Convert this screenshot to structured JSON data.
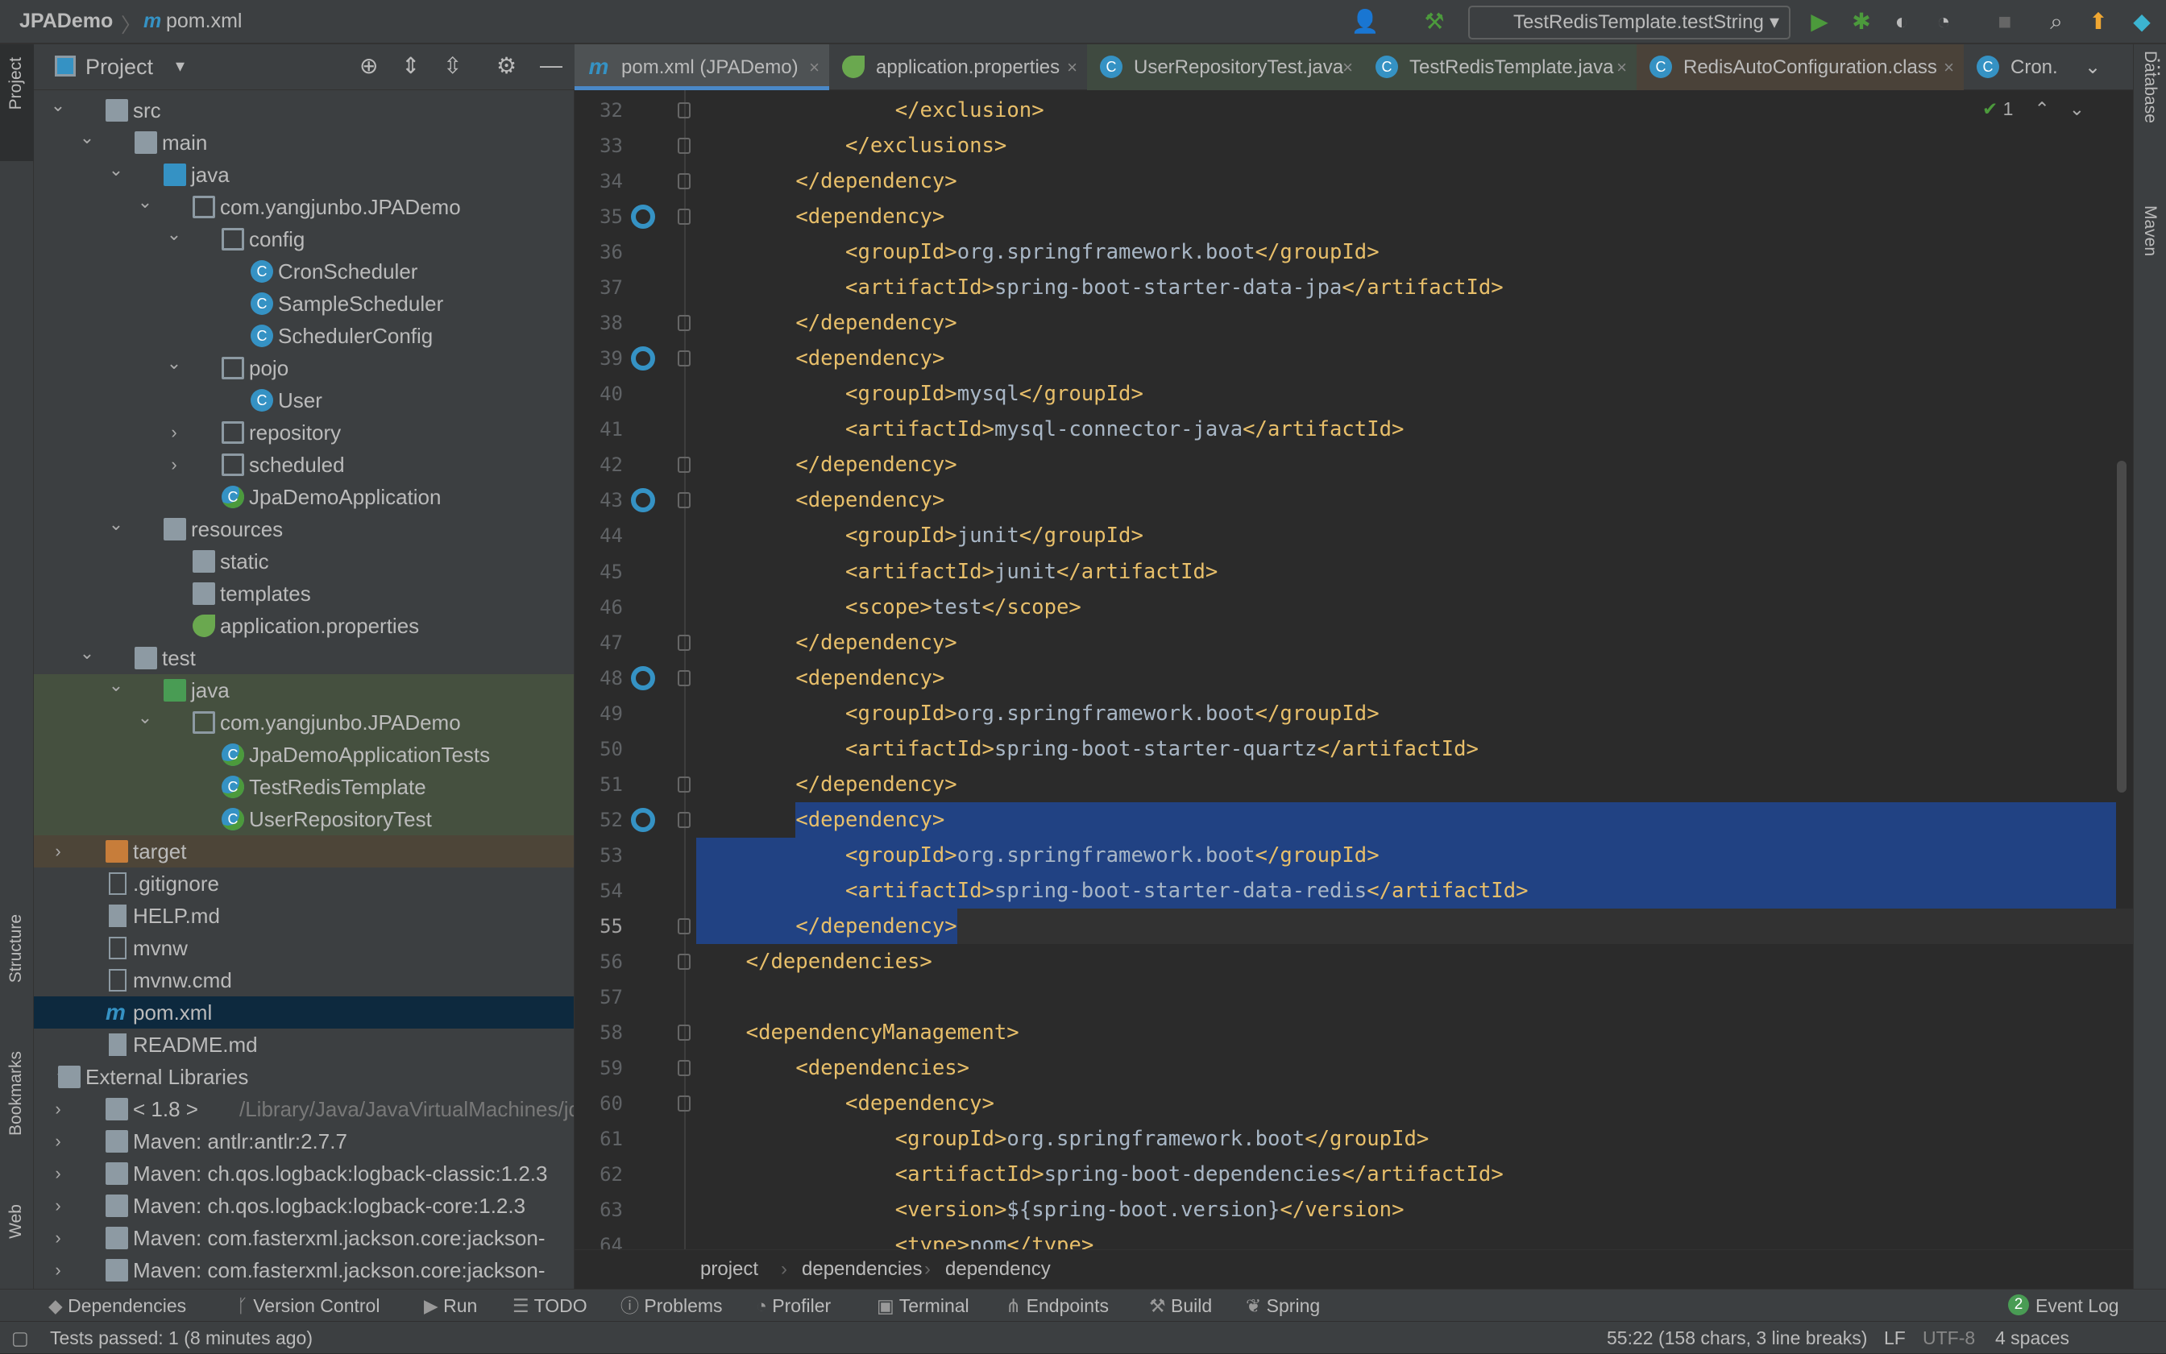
{
  "window": {
    "project": "JPADemo",
    "file": "pom.xml"
  },
  "toolbar_top": {
    "run_config": "TestRedisTemplate.testString",
    "icons": [
      "user-icon",
      "hammer-icon",
      "run-icon",
      "debug-icon",
      "coverage-icon",
      "profile-icon",
      "stop-icon",
      "search-icon",
      "update-icon",
      "jetbrains-icon"
    ]
  },
  "project_panel": {
    "title": "Project"
  },
  "tree": [
    {
      "label": "src",
      "level": 1,
      "arrow": "open",
      "icon": "folder"
    },
    {
      "label": "main",
      "level": 2,
      "arrow": "open",
      "icon": "folder"
    },
    {
      "label": "java",
      "level": 3,
      "arrow": "open",
      "icon": "folder-blue"
    },
    {
      "label": "com.yangjunbo.JPADemo",
      "level": 4,
      "arrow": "open",
      "icon": "package"
    },
    {
      "label": "config",
      "level": 5,
      "arrow": "open",
      "icon": "package"
    },
    {
      "label": "CronScheduler",
      "level": 6,
      "icon": "class"
    },
    {
      "label": "SampleScheduler",
      "level": 6,
      "icon": "class"
    },
    {
      "label": "SchedulerConfig",
      "level": 6,
      "icon": "class"
    },
    {
      "label": "pojo",
      "level": 5,
      "arrow": "open",
      "icon": "package"
    },
    {
      "label": "User",
      "level": 6,
      "icon": "class"
    },
    {
      "label": "repository",
      "level": 5,
      "arrow": "closed",
      "icon": "package"
    },
    {
      "label": "scheduled",
      "level": 5,
      "arrow": "closed",
      "icon": "package"
    },
    {
      "label": "JpaDemoApplication",
      "level": 5,
      "icon": "spring-class"
    },
    {
      "label": "resources",
      "level": 3,
      "arrow": "open",
      "icon": "folder-res"
    },
    {
      "label": "static",
      "level": 4,
      "icon": "folder"
    },
    {
      "label": "templates",
      "level": 4,
      "icon": "folder"
    },
    {
      "label": "application.properties",
      "level": 4,
      "icon": "spring-props"
    },
    {
      "label": "test",
      "level": 2,
      "arrow": "open",
      "icon": "folder"
    },
    {
      "label": "java",
      "level": 3,
      "arrow": "open",
      "icon": "folder-green",
      "bg": "test"
    },
    {
      "label": "com.yangjunbo.JPADemo",
      "level": 4,
      "arrow": "open",
      "icon": "package",
      "bg": "test"
    },
    {
      "label": "JpaDemoApplicationTests",
      "level": 5,
      "icon": "test-class",
      "bg": "test"
    },
    {
      "label": "TestRedisTemplate",
      "level": 5,
      "icon": "test-class",
      "bg": "test"
    },
    {
      "label": "UserRepositoryTest",
      "level": 5,
      "icon": "test-class",
      "bg": "test"
    },
    {
      "label": "target",
      "level": 1,
      "arrow": "closed",
      "icon": "folder-orange",
      "bg": "excluded"
    },
    {
      "label": ".gitignore",
      "level": 1,
      "icon": "file"
    },
    {
      "label": "HELP.md",
      "level": 1,
      "icon": "md"
    },
    {
      "label": "mvnw",
      "level": 1,
      "icon": "terminal"
    },
    {
      "label": "mvnw.cmd",
      "level": 1,
      "icon": "file"
    },
    {
      "label": "pom.xml",
      "level": 1,
      "icon": "maven",
      "bg": "selected"
    },
    {
      "label": "README.md",
      "level": 1,
      "icon": "md"
    },
    {
      "label": "External Libraries",
      "level": 0,
      "arrow": "open",
      "icon": "library"
    },
    {
      "label": "< 1.8 >",
      "extra": "/Library/Java/JavaVirtualMachines/jd",
      "level": 1,
      "arrow": "closed",
      "icon": "jdk"
    },
    {
      "label": "Maven: antlr:antlr:2.7.7",
      "level": 1,
      "arrow": "closed",
      "icon": "library"
    },
    {
      "label": "Maven: ch.qos.logback:logback-classic:1.2.3",
      "level": 1,
      "arrow": "closed",
      "icon": "library"
    },
    {
      "label": "Maven: ch.qos.logback:logback-core:1.2.3",
      "level": 1,
      "arrow": "closed",
      "icon": "library"
    },
    {
      "label": "Maven: com.fasterxml.jackson.core:jackson-",
      "level": 1,
      "arrow": "closed",
      "icon": "library"
    },
    {
      "label": "Maven: com.fasterxml.jackson.core:jackson-",
      "level": 1,
      "arrow": "closed",
      "icon": "library"
    }
  ],
  "tabs": [
    {
      "label": "pom.xml (JPADemo)",
      "icon": "m",
      "active": true
    },
    {
      "label": "application.properties",
      "icon": "spring"
    },
    {
      "label": "UserRepositoryTest.java",
      "icon": "C",
      "bg": "test"
    },
    {
      "label": "TestRedisTemplate.java",
      "icon": "C",
      "bg": "test"
    },
    {
      "label": "RedisAutoConfiguration.class",
      "icon": "C",
      "bg": "lib"
    },
    {
      "label": "Cron.",
      "icon": "C"
    }
  ],
  "inspection": {
    "count": "1"
  },
  "code": [
    {
      "n": "32",
      "i": 16,
      "t": "</exclusion>"
    },
    {
      "n": "33",
      "i": 12,
      "t": "</exclusions>"
    },
    {
      "n": "34",
      "i": 8,
      "t": "</dependency>"
    },
    {
      "n": "35",
      "i": 8,
      "t": "<dependency>",
      "g": true
    },
    {
      "n": "36",
      "i": 12,
      "t": "<groupId>org.springframework.boot</groupId>"
    },
    {
      "n": "37",
      "i": 12,
      "t": "<artifactId>spring-boot-starter-data-jpa</artifactId>"
    },
    {
      "n": "38",
      "i": 8,
      "t": "</dependency>"
    },
    {
      "n": "39",
      "i": 8,
      "t": "<dependency>",
      "g": true
    },
    {
      "n": "40",
      "i": 12,
      "t": "<groupId>mysql</groupId>"
    },
    {
      "n": "41",
      "i": 12,
      "t": "<artifactId>mysql-connector-java</artifactId>"
    },
    {
      "n": "42",
      "i": 8,
      "t": "</dependency>"
    },
    {
      "n": "43",
      "i": 8,
      "t": "<dependency>",
      "g": true
    },
    {
      "n": "44",
      "i": 12,
      "t": "<groupId>junit</groupId>"
    },
    {
      "n": "45",
      "i": 12,
      "t": "<artifactId>junit</artifactId>"
    },
    {
      "n": "46",
      "i": 12,
      "t": "<scope>test</scope>"
    },
    {
      "n": "47",
      "i": 8,
      "t": "</dependency>"
    },
    {
      "n": "48",
      "i": 8,
      "t": "<dependency>",
      "g": true
    },
    {
      "n": "49",
      "i": 12,
      "t": "<groupId>org.springframework.boot</groupId>"
    },
    {
      "n": "50",
      "i": 12,
      "t": "<artifactId>spring-boot-starter-quartz</artifactId>"
    },
    {
      "n": "51",
      "i": 8,
      "t": "</dependency>"
    },
    {
      "n": "52",
      "i": 8,
      "t": "<dependency>",
      "g": true
    },
    {
      "n": "53",
      "i": 12,
      "t": "<groupId>org.springframework.boot</groupId>"
    },
    {
      "n": "54",
      "i": 12,
      "t": "<artifactId>spring-boot-starter-data-redis</artifactId>"
    },
    {
      "n": "55",
      "i": 8,
      "t": "</dependency>"
    },
    {
      "n": "56",
      "i": 4,
      "t": "</dependencies>"
    },
    {
      "n": "57",
      "i": 0,
      "t": ""
    },
    {
      "n": "58",
      "i": 4,
      "t": "<dependencyManagement>"
    },
    {
      "n": "59",
      "i": 8,
      "t": "<dependencies>"
    },
    {
      "n": "60",
      "i": 12,
      "t": "<dependency>"
    },
    {
      "n": "61",
      "i": 16,
      "t": "<groupId>org.springframework.boot</groupId>"
    },
    {
      "n": "62",
      "i": 16,
      "t": "<artifactId>spring-boot-dependencies</artifactId>"
    },
    {
      "n": "63",
      "i": 16,
      "t": "<version>${spring-boot.version}</version>"
    },
    {
      "n": "64",
      "i": 16,
      "t": "<type>pom</type>"
    }
  ],
  "selection": {
    "from_line": "52",
    "from_col": 9,
    "to_line": "55",
    "to_col": 22
  },
  "breadcrumb": [
    "project",
    "dependencies",
    "dependency"
  ],
  "tool_windows": [
    "Dependencies",
    "Version Control",
    "Run",
    "TODO",
    "Problems",
    "Profiler",
    "Terminal",
    "Endpoints",
    "Build",
    "Spring"
  ],
  "event_log": {
    "label": "Event Log",
    "count": "2"
  },
  "side_tools": {
    "left": [
      "Project",
      "Structure",
      "Bookmarks",
      "Web"
    ],
    "right": [
      "Database",
      "Maven"
    ]
  },
  "status": {
    "message": "Tests passed: 1 (8 minutes ago)",
    "position": "55:22 (158 chars, 3 line breaks)",
    "line_sep": "LF",
    "encoding": "UTF-8",
    "indent": "4 spaces"
  },
  "colors": {
    "tag": "#e8bf6a",
    "text": "#a9b7c6",
    "selection": "#214283",
    "accent": "#4a88c7"
  }
}
